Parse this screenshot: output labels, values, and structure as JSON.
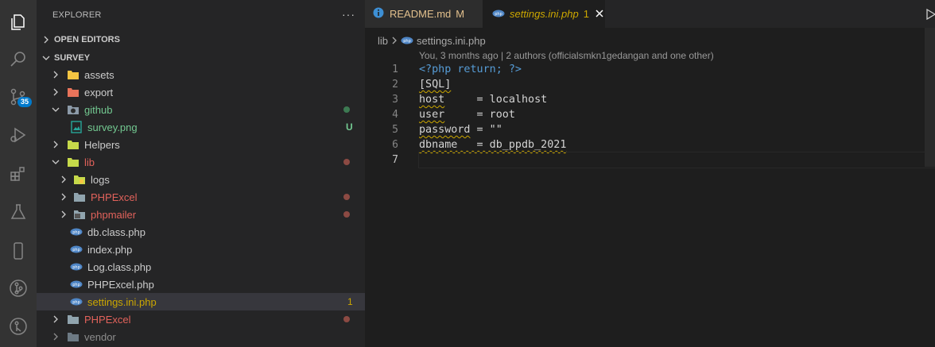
{
  "activity_bar": {
    "items": [
      "explorer-icon",
      "search-icon",
      "source-control-icon",
      "run-debug-icon",
      "extensions-icon",
      "testing-icon",
      "remote-device-icon",
      "git-graph-icon",
      "gitlens-icon"
    ],
    "source_control_badge": "35"
  },
  "sidebar": {
    "title": "EXPLORER",
    "more_label": "···",
    "open_editors_label": "OPEN EDITORS",
    "project_label": "SURVEY",
    "items": [
      {
        "label": "assets",
        "decoration": "",
        "color": "#cccccc"
      },
      {
        "label": "export",
        "decoration": "",
        "color": "#cccccc"
      },
      {
        "label": "github",
        "decoration": "",
        "color": "#73c991"
      },
      {
        "label": "survey.png",
        "decoration": "U",
        "color": "#73c991"
      },
      {
        "label": "Helpers",
        "decoration": "",
        "color": "#cccccc"
      },
      {
        "label": "lib",
        "decoration": "",
        "color": "#e2625b"
      },
      {
        "label": "logs",
        "decoration": "",
        "color": "#cccccc"
      },
      {
        "label": "PHPExcel",
        "decoration": "",
        "color": "#e2625b"
      },
      {
        "label": "phpmailer",
        "decoration": "",
        "color": "#e2625b"
      },
      {
        "label": "db.class.php",
        "decoration": "",
        "color": "#cccccc"
      },
      {
        "label": "index.php",
        "decoration": "",
        "color": "#cccccc"
      },
      {
        "label": "Log.class.php",
        "decoration": "",
        "color": "#cccccc"
      },
      {
        "label": "PHPExcel.php",
        "decoration": "",
        "color": "#cccccc"
      },
      {
        "label": "settings.ini.php",
        "decoration": "1",
        "color": "#cca700"
      },
      {
        "label": "PHPExcel",
        "decoration": "",
        "color": "#e2625b"
      },
      {
        "label": "vendor",
        "decoration": "",
        "color": "#8c8c8c"
      }
    ]
  },
  "tabs": [
    {
      "label": "README.md",
      "decoration": "M"
    },
    {
      "label": "settings.ini.php",
      "decoration": "1"
    }
  ],
  "breadcrumb": {
    "folder": "lib",
    "file": "settings.ini.php"
  },
  "blame": "You, 3 months ago | 2 authors (officialsmkn1gedangan and one other)",
  "code": {
    "line_numbers": [
      "1",
      "2",
      "3",
      "4",
      "5",
      "6",
      "7"
    ],
    "line1_open": "<?php",
    "line1_return": "return;",
    "line1_close": "?>",
    "line2": "[SQL]",
    "line3_key": "host",
    "line3_rest": "     = localhost",
    "line4_key": "user",
    "line4_rest": "     = root",
    "line5_key": "password",
    "line5_rest": " = \"\"",
    "line6_key": "dbname",
    "line6_rest": "   = db_ppdb_2021",
    "line7": ""
  },
  "colors": {
    "accent": "#007acc",
    "warning": "#cca700",
    "untracked": "#73c991",
    "error_folder": "#e2625b"
  }
}
